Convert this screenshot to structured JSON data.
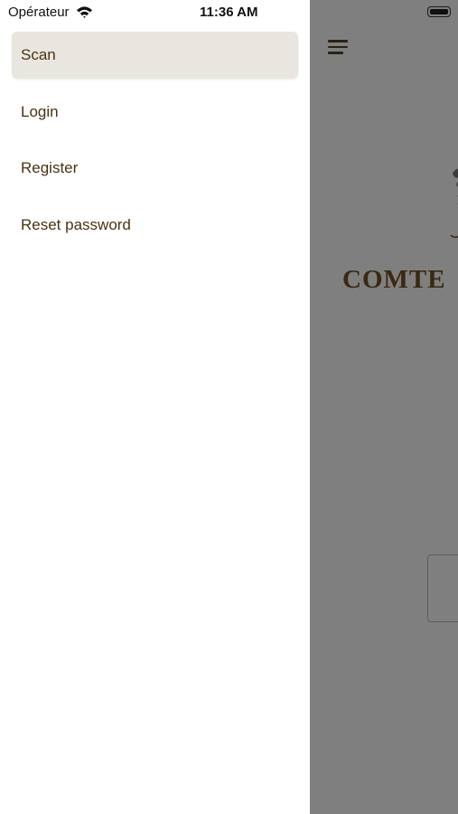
{
  "status_bar": {
    "carrier": "Opérateur",
    "time": "11:36 AM",
    "wifi_icon": "wifi-icon",
    "battery_icon": "battery-icon"
  },
  "drawer": {
    "menu_items": [
      {
        "label": "Scan",
        "active": true
      },
      {
        "label": "Login",
        "active": false
      },
      {
        "label": "Register",
        "active": false
      },
      {
        "label": "Reset password",
        "active": false
      }
    ]
  },
  "background_app": {
    "menu_icon": "hamburger-menu-icon",
    "brand_text": "COMTE"
  },
  "colors": {
    "menu_text": "#4a3212",
    "active_item_bg": "#e9e6df",
    "overlay": "#7f7f7f",
    "brand": "#3a2811"
  }
}
